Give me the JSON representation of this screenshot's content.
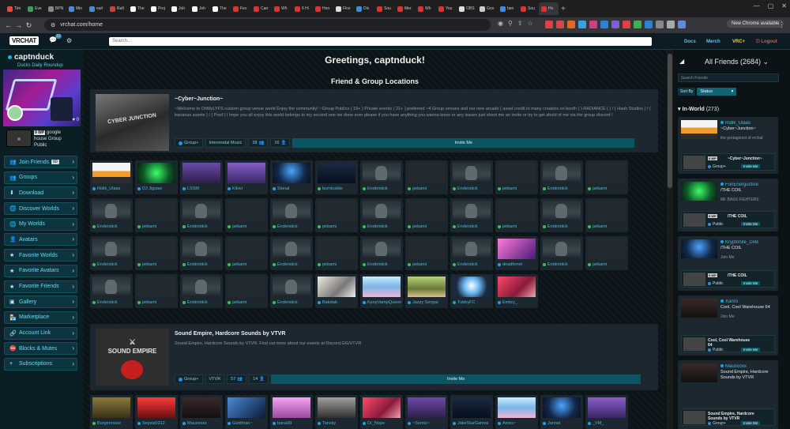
{
  "browser": {
    "tabs": [
      {
        "title": "Tim",
        "color": "#e04b3c"
      },
      {
        "title": "Eve",
        "color": "#3c9e5a"
      },
      {
        "title": "BPN",
        "color": "#888888"
      },
      {
        "title": "Min",
        "color": "#4a8bd6"
      },
      {
        "title": "earl",
        "color": "#4a8bd6"
      },
      {
        "title": "Rafi",
        "color": "#c84141"
      },
      {
        "title": "The",
        "color": "#ffffff"
      },
      {
        "title": "Proj",
        "color": "#ffffff"
      },
      {
        "title": "Joh",
        "color": "#ffffff"
      },
      {
        "title": "Joh",
        "color": "#ffffff"
      },
      {
        "title": "The",
        "color": "#ffffff"
      },
      {
        "title": "Fev",
        "color": "#e03030"
      },
      {
        "title": "Carr",
        "color": "#e03030"
      },
      {
        "title": "Wh",
        "color": "#e03030"
      },
      {
        "title": "6 Hi",
        "color": "#e03030"
      },
      {
        "title": "Hon",
        "color": "#e03030"
      },
      {
        "title": "Flox",
        "color": "#dddddd"
      },
      {
        "title": "Dix",
        "color": "#3c8de0"
      },
      {
        "title": "Sou",
        "color": "#e03030"
      },
      {
        "title": "Mer",
        "color": "#e03030"
      },
      {
        "title": "Wh",
        "color": "#e03030"
      },
      {
        "title": "You",
        "color": "#e03030"
      },
      {
        "title": "OBS",
        "color": "#dddddd"
      },
      {
        "title": "Goo",
        "color": "#cccccc"
      },
      {
        "title": "ben",
        "color": "#3c8de0"
      },
      {
        "title": "Sou",
        "color": "#e03030"
      },
      {
        "title": "Ho",
        "color": "#e03030",
        "active": true
      }
    ],
    "url": "vrchat.com/home",
    "update_label": "New Chrome available",
    "extension_colors": [
      "#e04040",
      "#d04a4a",
      "#e06a20",
      "#3ba0e0",
      "#d04080",
      "#2f80d0",
      "#8060d0",
      "#e04040",
      "#3cb050",
      "#2f80d0",
      "#888888",
      "#aaaaaa",
      "#5e8ae0"
    ]
  },
  "header": {
    "logo": "VRCHAT",
    "notif_count": "10",
    "search_placeholder": "Search...",
    "links": {
      "docs": "Docs",
      "merch": "Merch",
      "vrc_plus": "VRC+",
      "logout": "Logout"
    }
  },
  "left": {
    "username": "captnduck",
    "status": "Ducks Daily Roundup",
    "avatar_count": "0",
    "world": {
      "badge": "9 WP",
      "line1": "google",
      "line2": "house",
      "line3": "Group",
      "line4": "Public"
    },
    "nav": [
      {
        "label": "Join Friends",
        "icon": "👥",
        "count": "60"
      },
      {
        "label": "Groups",
        "icon": "👥"
      },
      {
        "label": "Download",
        "icon": "⬇"
      },
      {
        "label": "Discover Worlds",
        "icon": "🌐"
      },
      {
        "label": "My Worlds",
        "icon": "🌐"
      },
      {
        "label": "Avatars",
        "icon": "👤"
      },
      {
        "label": "Favorite Worlds",
        "icon": "★"
      },
      {
        "label": "Favorite Avatars",
        "icon": "★"
      },
      {
        "label": "Favorite Friends",
        "icon": "★"
      },
      {
        "label": "Gallery",
        "icon": "▣"
      },
      {
        "label": "Marketplace",
        "icon": "🏪"
      },
      {
        "label": "Account Link",
        "icon": "🔗"
      },
      {
        "label": "Blocks & Mutes",
        "icon": "⛔"
      },
      {
        "label": "Subscriptions",
        "icon": "+"
      }
    ]
  },
  "main": {
    "greeting": "Greetings, captnduck!",
    "section_title": "Friend & Group Locations",
    "world1": {
      "name": "~Cyber~Junction~",
      "description": "~Welcome to OhMyLYFS custom group venue world Enjoy the community! ~Group Publics ( 18+ ) Private events ( 21+ ) preferred ~4 Group venues and our new arcade ( asset credit to many creators on booth ( ) RADIANCE ( ) / ( Hash Studios ) / ( bananas assets ) / ( Poof ) I hope you all enjoy this world belongs to my second one ive done ever please if you have anything you wanna know or any issues just shoot me an invite or try to get ahold of me via the group discord !",
      "access": "Group+",
      "group": "Intermodal Music",
      "capacity": "38",
      "friends": "16",
      "invite": "Invite Me"
    },
    "friends1": [
      {
        "name": "Ridik_Ulaas",
        "img": "euro",
        "dot": "blue"
      },
      {
        "name": "DJ Jigsaw",
        "img": "green",
        "dot": "blue"
      },
      {
        "name": "LSSM",
        "img": "purple",
        "dot": "blue"
      },
      {
        "name": "Kikivi",
        "img": "purple2",
        "dot": "blue"
      },
      {
        "name": "Sional",
        "img": "night",
        "dot": "blue"
      },
      {
        "name": "burntcable",
        "img": "dark",
        "dot": "green"
      },
      {
        "name": "Enderstick",
        "img": "ender",
        "dot": "green"
      },
      {
        "name": "pebami",
        "img": "dim",
        "dot": "green"
      },
      {
        "name": "Enderstick",
        "img": "ender",
        "dot": "green"
      },
      {
        "name": "pebami",
        "img": "dim",
        "dot": "green"
      },
      {
        "name": "Enderstick",
        "img": "ender",
        "dot": "green"
      },
      {
        "name": "pebami",
        "img": "dim",
        "dot": "green"
      },
      {
        "name": "Enderstick",
        "img": "ender",
        "dot": "green"
      },
      {
        "name": "pebami",
        "img": "dim",
        "dot": "green"
      },
      {
        "name": "Enderstick",
        "img": "ender",
        "dot": "green"
      },
      {
        "name": "pebami",
        "img": "dim",
        "dot": "green"
      },
      {
        "name": "Enderstick",
        "img": "ender",
        "dot": "green"
      },
      {
        "name": "pebami",
        "img": "dim",
        "dot": "green"
      },
      {
        "name": "Enderstick",
        "img": "ender",
        "dot": "green"
      },
      {
        "name": "pebami",
        "img": "dim",
        "dot": "green"
      },
      {
        "name": "Enderstick",
        "img": "ender",
        "dot": "green"
      },
      {
        "name": "pebami",
        "img": "dim",
        "dot": "green"
      },
      {
        "name": "Enderstick",
        "img": "ender",
        "dot": "green"
      },
      {
        "name": "pebami",
        "img": "dim",
        "dot": "green"
      },
      {
        "name": "Enderstick",
        "img": "ender",
        "dot": "green"
      },
      {
        "name": "pebami",
        "img": "dim",
        "dot": "green"
      },
      {
        "name": "Enderstick",
        "img": "ender",
        "dot": "green"
      },
      {
        "name": "pebami",
        "img": "dim",
        "dot": "green"
      },
      {
        "name": "Enderstick",
        "img": "ender",
        "dot": "green"
      },
      {
        "name": "pebami",
        "img": "dim",
        "dot": "green"
      },
      {
        "name": "Enderstick",
        "img": "ender",
        "dot": "green"
      },
      {
        "name": "pebami",
        "img": "dim",
        "dot": "green"
      },
      {
        "name": "Enderstick",
        "img": "ender",
        "dot": "green"
      },
      {
        "name": "deadferret",
        "img": "pink",
        "dot": "blue"
      },
      {
        "name": "Enderstick",
        "img": "ender",
        "dot": "green"
      },
      {
        "name": "pebami",
        "img": "dim",
        "dot": "green"
      },
      {
        "name": "Enderstick",
        "img": "ender",
        "dot": "green"
      },
      {
        "name": "pebami",
        "img": "dim",
        "dot": "green"
      },
      {
        "name": "Enderstick",
        "img": "ender",
        "dot": "green"
      },
      {
        "name": "pebami",
        "img": "dim",
        "dot": "green"
      },
      {
        "name": "Enderstick",
        "img": "ender",
        "dot": "green"
      },
      {
        "name": "Babdab",
        "img": "sketch",
        "dot": "blue"
      },
      {
        "name": "KpopVampQueen",
        "img": "ice",
        "dot": "blue"
      },
      {
        "name": "Jazzy Senpai",
        "img": "olive",
        "dot": "blue"
      },
      {
        "name": "TubbyFC",
        "img": "blueface",
        "dot": "blue"
      },
      {
        "name": "Embry_",
        "img": "redpink",
        "dot": "blue"
      }
    ],
    "world2": {
      "name": "Sound Empire, Hardcore Sounds by VTVR",
      "description": "Sound Empire, Hardcore Sounds by VTVR. Find out more about our events at Discord.GG/VTVR",
      "access": "Group+",
      "group": "VTVR",
      "capacity": "57",
      "friends": "14",
      "invite": "Invite Me"
    },
    "friends2": [
      {
        "name": "Burgermeier",
        "img": "olive2",
        "dot": "green"
      },
      {
        "name": "Sepsis0312",
        "img": "red",
        "dot": "blue"
      },
      {
        "name": "Mausvoxx",
        "img": "dark2",
        "dot": "blue"
      },
      {
        "name": "Goldman~",
        "img": "blue2",
        "dot": "blue"
      },
      {
        "name": "bana99",
        "img": "pink2",
        "dot": "blue"
      },
      {
        "name": "Tansky",
        "img": "grey",
        "dot": "blue"
      },
      {
        "name": "Dr_Nope",
        "img": "redpink",
        "dot": "blue"
      },
      {
        "name": "~Somio~",
        "img": "purple",
        "dot": "blue"
      },
      {
        "name": "JakeStarGames",
        "img": "dark",
        "dot": "blue"
      },
      {
        "name": "Ames~",
        "img": "ice",
        "dot": "blue"
      },
      {
        "name": "Jannet",
        "img": "night",
        "dot": "blue"
      },
      {
        "name": "_VM_",
        "img": "purple2",
        "dot": "blue"
      }
    ]
  },
  "right": {
    "title": "All Friends (2684)",
    "search_placeholder": "Search Friends",
    "sort_label": "Sort By",
    "sort_value": "Status",
    "section": "In-World",
    "section_count": "(273)",
    "friends": [
      {
        "name": "Ridik_Ulaas",
        "world": "~Cyber~Junction~",
        "status": "the protagonist of vrchat",
        "sub_world": "~Cyber~Junction~",
        "access": "Group+",
        "invite": "Invite Me",
        "img": "euro"
      },
      {
        "name": "FonEnergustice",
        "world": "/THE COIL",
        "status": "MF BASS FIGHTERS",
        "sub_world": "/THE COIL",
        "access": "Public",
        "invite": "Invite Me",
        "img": "green"
      },
      {
        "name": "Kryptonite_DnB",
        "world": "/THE COIL",
        "status": "Join Me",
        "sub_world": "/THE COIL",
        "access": "Public",
        "invite": "Invite Me",
        "img": "night"
      },
      {
        "name": "Xanro",
        "world": "Cool, Cool Warehouse 64",
        "status": "Join Me",
        "sub_world": "Cool, Cool Warehouse 64",
        "access": "Public",
        "invite": "Invite Me",
        "img": "dark2"
      },
      {
        "name": "Mausvoxx",
        "world": "Sound Empire, Hardcore Sounds by VTVR",
        "status": "",
        "sub_world": "Sound Empire, Hardcore Sounds by VTVR",
        "access": "Group+",
        "invite": "Invite Me",
        "img": "dark2"
      }
    ]
  }
}
